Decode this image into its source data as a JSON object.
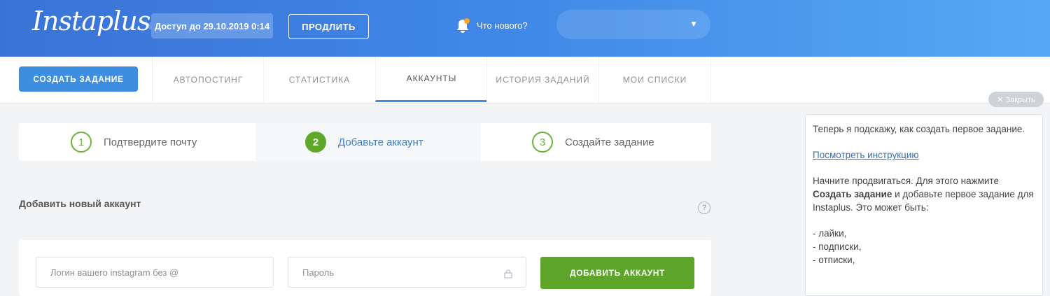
{
  "header": {
    "logo": "Instaplus",
    "access_text": "Доступ до 29.10.2019 0:14",
    "extend_label": "ПРОДЛИТЬ",
    "news_label": "Что нового?"
  },
  "tabs": {
    "create_label": "СОЗДАТЬ ЗАДАНИЕ",
    "items": [
      {
        "label": "АВТОПОСТИНГ"
      },
      {
        "label": "СТАТИСТИКА"
      },
      {
        "label": "АККАУНТЫ"
      },
      {
        "label": "ИСТОРИЯ ЗАДАНИЙ"
      },
      {
        "label": "МОИ СПИСКИ"
      }
    ],
    "active_index": 2
  },
  "close_label": "✕ Закрыть",
  "steps": [
    {
      "number": "1",
      "label": "Подтвердите почту"
    },
    {
      "number": "2",
      "label": "Добавьте аккаунт"
    },
    {
      "number": "3",
      "label": "Создайте задание"
    }
  ],
  "add_account": {
    "title": "Добавить новый аккаунт",
    "help": "?",
    "login_placeholder": "Логин вашего instagram без @",
    "password_placeholder": "Пароль",
    "button_label": "ДОБАВИТЬ АККАУНТ"
  },
  "hint": {
    "intro": "Теперь я подскажу, как создать первое задание.",
    "link": "Посмотреть инструкцию",
    "text_before": "Начните продвигаться. Для этого нажмите ",
    "text_bold": "Создать задание",
    "text_after": " и добавьте первое задание для Instaplus. Это может быть:",
    "list": [
      "- лайки,",
      "- подписки,",
      "- отписки,"
    ]
  },
  "colors": {
    "header_start": "#3a73d6",
    "header_end": "#55a9f4",
    "accent_blue": "#3d8ee0",
    "accent_green": "#5da52a",
    "badge_orange": "#f5a623"
  }
}
